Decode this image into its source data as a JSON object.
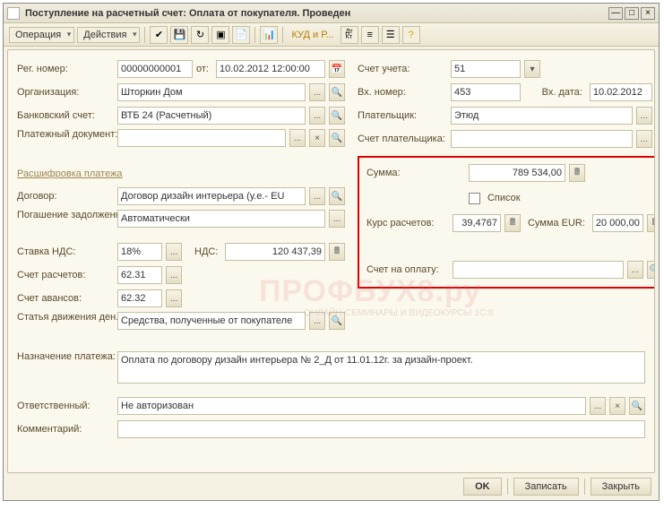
{
  "window": {
    "title": "Поступление на расчетный счет: Оплата от покупателя. Проведен"
  },
  "toolbar": {
    "operation": "Операция",
    "actions": "Действия",
    "kud": "КУД и Р..."
  },
  "left": {
    "reg_number_lbl": "Рег. номер:",
    "reg_number": "00000000001",
    "ot_lbl": "от:",
    "ot_val": "10.02.2012 12:00:00",
    "org_lbl": "Организация:",
    "org_val": "Шторкин Дом",
    "bank_lbl": "Банковский счет:",
    "bank_val": "ВТБ 24 (Расчетный)",
    "paydoc_lbl": "Платежный документ:",
    "paydoc_val": "",
    "section": "Расшифровка платежа",
    "contract_lbl": "Договор:",
    "contract_val": "Договор дизайн интерьера (у.е.- EU",
    "pogash_lbl": "Погашение задолженности:",
    "pogash_val": "Автоматически",
    "stavka_lbl": "Ставка НДС:",
    "stavka_val": "18%",
    "nds_lbl": "НДС:",
    "nds_val": "120 437,39",
    "sr_lbl": "Счет расчетов:",
    "sr_val": "62.31",
    "sa_lbl": "Счет авансов:",
    "sa_val": "62.32",
    "sdv_lbl": "Статья движения ден. средств:",
    "sdv_val": "Средства, полученные от покупателе"
  },
  "right": {
    "su_lbl": "Счет учета:",
    "su_val": "51",
    "vn_lbl": "Вх. номер:",
    "vn_val": "453",
    "vd_lbl": "Вх. дата:",
    "vd_val": "10.02.2012",
    "pl_lbl": "Плательщик:",
    "pl_val": "Этюд",
    "spl_lbl": "Счет плательщика:",
    "spl_val": "",
    "sum_lbl": "Сумма:",
    "sum_val": "789 534,00",
    "list_lbl": "Список",
    "kurs_lbl": "Курс расчетов:",
    "kurs_val": "39,4767",
    "sume_lbl": "Сумма EUR:",
    "sume_val": "20 000,00",
    "sno_lbl": "Счет на оплату:",
    "sno_val": ""
  },
  "bottom": {
    "np_lbl": "Назначение платежа:",
    "np_val": "Оплата по договору дизайн интерьера № 2_Д от 11.01.12г. за дизайн-проект.",
    "otv_lbl": "Ответственный:",
    "otv_val": "Не авторизован",
    "kom_lbl": "Комментарий:",
    "kom_val": ""
  },
  "footer": {
    "ok": "OK",
    "write": "Записать",
    "close": "Закрыть"
  },
  "watermark": "ПРОФБУХ8.ру",
  "watermark_sub": "ОНЛАЙН-СЕМИНАРЫ И ВИДЕОКУРСЫ 1С:8"
}
